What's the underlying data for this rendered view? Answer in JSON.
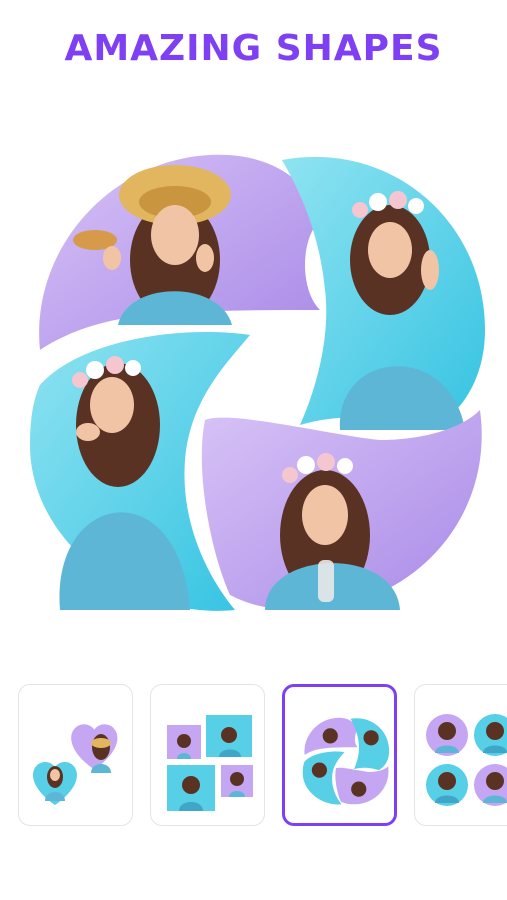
{
  "header": {
    "title": "AMAZING SHAPES"
  },
  "colors": {
    "accent": "#7f3ff2",
    "lavender": "#c5a6f2",
    "cyan": "#56cfe7",
    "dress": "#5eb6d6",
    "hair": "#5a3223",
    "skin": "#f2c4a6"
  },
  "shape_templates": [
    {
      "name": "hearts",
      "selected": false
    },
    {
      "name": "squares-grid",
      "selected": false
    },
    {
      "name": "swirl-circle",
      "selected": true
    },
    {
      "name": "four-circles",
      "selected": false
    }
  ]
}
